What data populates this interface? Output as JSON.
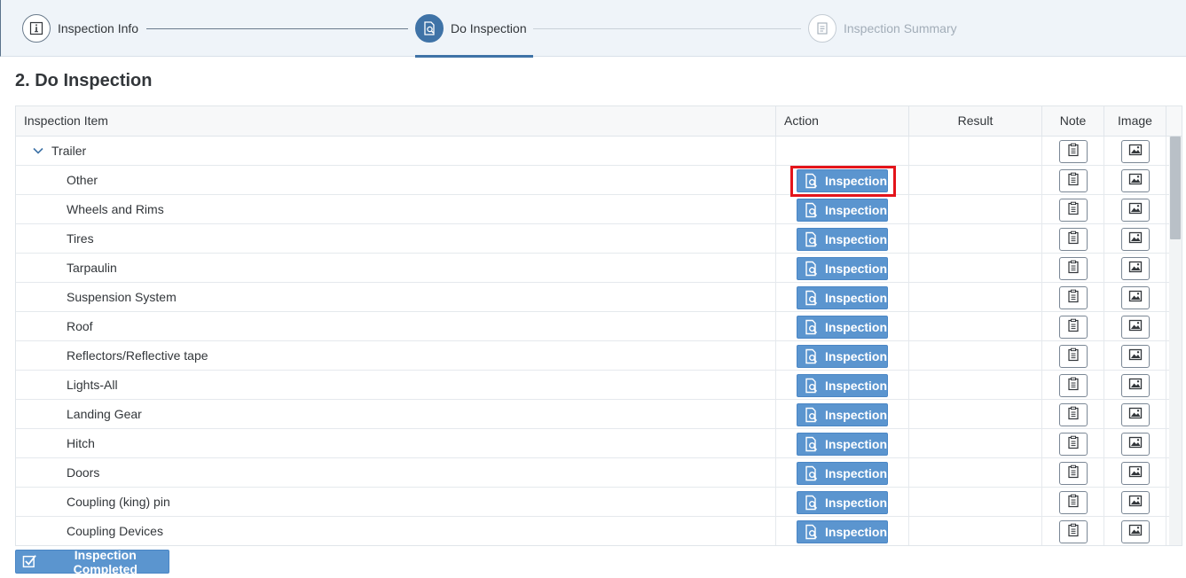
{
  "wizard": {
    "steps": [
      {
        "label": "Inspection Info",
        "icon": "info-icon",
        "state": "completed"
      },
      {
        "label": "Do Inspection",
        "icon": "document-search-icon",
        "state": "active"
      },
      {
        "label": "Inspection Summary",
        "icon": "summary-icon",
        "state": "disabled"
      }
    ]
  },
  "page": {
    "title": "2. Do Inspection"
  },
  "table": {
    "columns": [
      "Inspection Item",
      "Action",
      "Result",
      "Note",
      "Image"
    ],
    "group_label": "Trailer",
    "action_label": "Inspection",
    "items": [
      "Other",
      "Wheels and Rims",
      "Tires",
      "Tarpaulin",
      "Suspension System",
      "Roof",
      "Reflectors/Reflective tape",
      "Lights-All",
      "Landing Gear",
      "Hitch",
      "Doors",
      "Coupling (king) pin",
      "Coupling Devices"
    ]
  },
  "footer": {
    "complete_label": "Inspection Completed"
  },
  "colors": {
    "accent": "#5b95cf",
    "highlight": "#e3141b",
    "active_step": "#3f73a7"
  }
}
